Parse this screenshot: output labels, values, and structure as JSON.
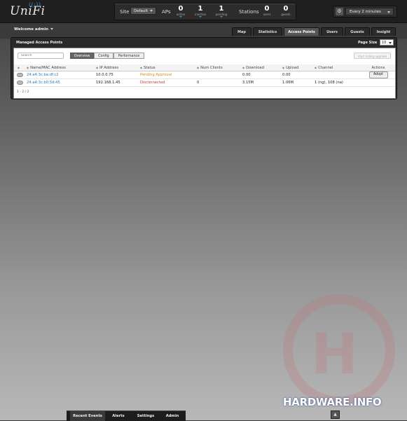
{
  "app": {
    "logo": "UniFi"
  },
  "header": {
    "site_label": "Site",
    "site_value": "Default",
    "aps_label": "APs",
    "aps": [
      {
        "num": "0",
        "sub": "active"
      },
      {
        "num": "1",
        "sub": "inactive"
      },
      {
        "num": "1",
        "sub": "pending"
      }
    ],
    "stations_label": "Stations",
    "stations": [
      {
        "num": "0",
        "sub": "users"
      },
      {
        "num": "0",
        "sub": "guests"
      }
    ],
    "refresh_value": "Every 2 minutes"
  },
  "welcome": "Welcome admin",
  "nav_tabs": [
    "Map",
    "Statistics",
    "Access Points",
    "Users",
    "Guests",
    "Insight"
  ],
  "active_tab": "Access Points",
  "panel": {
    "title": "Managed Access Points",
    "page_size_label": "Page Size",
    "page_size_value": "10",
    "search_placeholder": "Search",
    "view_tabs": [
      "Overview",
      "Config",
      "Performance"
    ],
    "rolling_button": "start rolling upgrade",
    "columns": [
      "Name/MAC Address",
      "IP Address",
      "Status",
      "Num Clients",
      "Download",
      "Upload",
      "Channel",
      "Actions"
    ],
    "rows": [
      {
        "name": "24:a4:3c:ba:df:c2",
        "ip": "10.0.0.75",
        "status": "Pending Approval",
        "clients": "",
        "download": "0.00",
        "upload": "0.00",
        "channel": "",
        "action": "Adopt"
      },
      {
        "name": "24:a4:3c:b0:5d:45",
        "ip": "192.168.1.45",
        "status": "Disconnected",
        "clients": "0",
        "download": "3.15M",
        "upload": "1.06M",
        "channel": "1 (ng), 108 (na)",
        "action": ""
      }
    ],
    "pager": "1 - 2 / 2"
  },
  "bottom_tabs": [
    "Recent Events",
    "Alerts",
    "Settings",
    "Admin"
  ],
  "watermark": {
    "text": "HARDWARE.INFO",
    "letter": "H"
  },
  "colors": {
    "link": "#2e79b9",
    "pending": "#d98a1b",
    "disconnected": "#c0392b",
    "accent": "#3a9ad9"
  }
}
